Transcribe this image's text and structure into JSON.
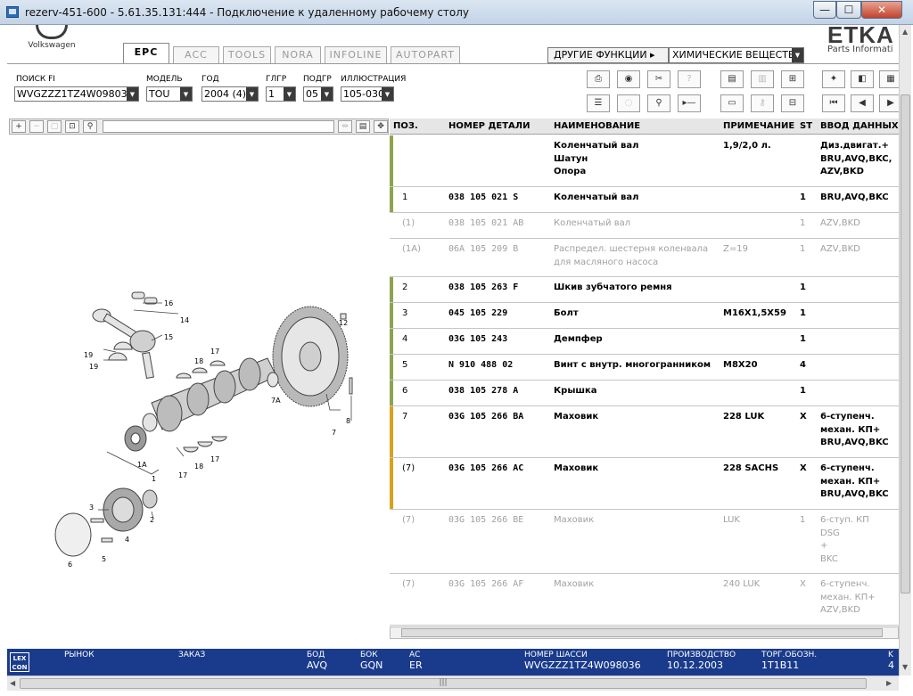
{
  "window": {
    "title": "rezerv-451-600 - 5.61.35.131:444 - Подключение к удаленному рабочему столу",
    "min_label": "—",
    "max_label": "☐",
    "close_label": "✕"
  },
  "brand": {
    "logo_text": "Volkswagen",
    "app_name": "ETKA",
    "app_sub": "Parts Informati"
  },
  "tabs": [
    {
      "label": "EPC"
    },
    {
      "label": "ACC"
    },
    {
      "label": "TOOLS"
    },
    {
      "label": "NORA"
    },
    {
      "label": "INFOLINE"
    },
    {
      "label": "AUTOPART"
    }
  ],
  "functions": {
    "button_label": "ДРУГИЕ ФУНКЦИИ ▸",
    "select_value": "ХИМИЧЕСКИЕ ВЕЩЕСТВ"
  },
  "filters": [
    {
      "label": "ПОИСК FI",
      "value": "WVGZZZ1TZ4W09803"
    },
    {
      "label": "МОДЕЛЬ",
      "value": "TOU"
    },
    {
      "label": "ГОД",
      "value": "2004 (4)"
    },
    {
      "label": "ГЛГР",
      "value": "1"
    },
    {
      "label": "ПОДГР",
      "value": "05"
    },
    {
      "label": "ИЛЛЮСТРАЦИЯ",
      "value": "105-030"
    }
  ],
  "table": {
    "headers": {
      "pos": "ПОЗ.",
      "part": "НОМЕР ДЕТАЛИ",
      "name": "НАИМЕНОВАНИЕ",
      "note": "ПРИМЕЧАНИЕ",
      "st": "ST",
      "input": "ВВОД ДАННЫХ"
    },
    "rows": [
      {
        "pos": "",
        "part": "",
        "name": "Коленчатый вал\nШатун\nОпора",
        "note": "1,9/2,0 л.",
        "st": "",
        "input": "Диз.двигат.+\nBRU,AVQ,BKC,\nAZV,BKD",
        "dim": false,
        "bar": "#8fa34c"
      },
      {
        "pos": "1",
        "part": "038  105  021  S",
        "name": "Коленчатый вал",
        "note": "",
        "st": "1",
        "input": "BRU,AVQ,BKC",
        "dim": false,
        "bar": "#8fa34c"
      },
      {
        "pos": "(1)",
        "part": "038  105  021  AB",
        "name": "Коленчатый вал",
        "note": "",
        "st": "1",
        "input": "AZV,BKD",
        "dim": true,
        "bar": ""
      },
      {
        "pos": "(1A)",
        "part": "06A  105  209  B",
        "name": "Распредел. шестерня коленвала\nдля масляного насоса",
        "note": "Z=19",
        "st": "1",
        "input": "AZV,BKD",
        "dim": true,
        "bar": ""
      },
      {
        "pos": "2",
        "part": "038  105  263  F",
        "name": "Шкив зубчатого ремня",
        "note": "",
        "st": "1",
        "input": "",
        "dim": false,
        "bar": "#8fa34c"
      },
      {
        "pos": "3",
        "part": "045  105  229",
        "name": "Болт",
        "note": "M16X1,5X59",
        "st": "1",
        "input": "",
        "dim": false,
        "bar": "#8fa34c"
      },
      {
        "pos": "4",
        "part": "03G  105  243",
        "name": "Демпфер",
        "note": "",
        "st": "1",
        "input": "",
        "dim": false,
        "bar": "#8fa34c"
      },
      {
        "pos": "5",
        "part": "N    910  488  02",
        "name": "Винт с внутр. многогранником",
        "note": "M8X20",
        "st": "4",
        "input": "",
        "dim": false,
        "bar": "#8fa34c"
      },
      {
        "pos": "6",
        "part": "038  105  278  A",
        "name": "Крышка",
        "note": "",
        "st": "1",
        "input": "",
        "dim": false,
        "bar": "#8fa34c"
      },
      {
        "pos": "7",
        "part": "03G  105  266  BA",
        "name": "Маховик",
        "note": "228       LUK",
        "st": "X",
        "input": "6-ступенч.\nмехан. КП+\nBRU,AVQ,BKC",
        "dim": false,
        "bar": "#d9a21c"
      },
      {
        "pos": "(7)",
        "part": "03G  105  266  AC",
        "name": "Маховик",
        "note": "228       SACHS",
        "st": "X",
        "input": "6-ступенч.\nмехан. КП+\nBRU,AVQ,BKC",
        "dim": false,
        "bar": "#d9a21c"
      },
      {
        "pos": "(7)",
        "part": "03G  105  266  BE",
        "name": "Маховик",
        "note": "               LUK",
        "st": "1",
        "input": "6-ступ. КП\nDSG\n+\nBKC",
        "dim": true,
        "bar": ""
      },
      {
        "pos": "(7)",
        "part": "03G  105  266  AF",
        "name": "Маховик",
        "note": "240       LUK",
        "st": "X",
        "input": "6-ступенч.\nмехан. КП+\nAZV,BKD",
        "dim": true,
        "bar": ""
      }
    ]
  },
  "callouts": [
    "16",
    "14",
    "15",
    "19",
    "19",
    "18",
    "17",
    "12",
    "7A",
    "8",
    "7",
    "1A",
    "1",
    "17",
    "18",
    "17",
    "2",
    "3",
    "4",
    "5",
    "6"
  ],
  "status": {
    "logo": "LEX\nCON",
    "fields": [
      {
        "label": "РЫНОК",
        "value": ""
      },
      {
        "label": "ЗАКАЗ",
        "value": ""
      },
      {
        "label": "БОД",
        "value": "AVQ"
      },
      {
        "label": "БОК",
        "value": "GQN"
      },
      {
        "label": "АС",
        "value": "ER"
      },
      {
        "label": "НОМЕР ШАССИ",
        "value": "WVGZZZ1TZ4W098036"
      },
      {
        "label": "ПРОИЗВОДСТВО",
        "value": "10.12.2003"
      },
      {
        "label": "ТОРГ.ОБОЗН.",
        "value": "1T1B11"
      },
      {
        "label": "K",
        "value": "4"
      }
    ]
  }
}
